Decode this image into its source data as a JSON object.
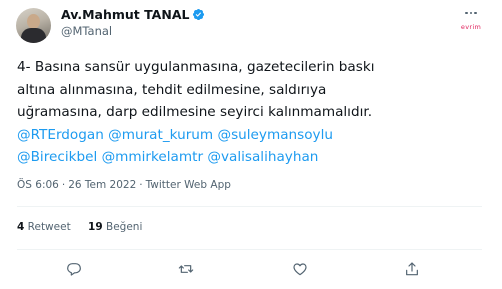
{
  "author": {
    "name": "Av.Mahmut TANAL",
    "handle": "@MTanal",
    "avatar_icon": "avatar-photo",
    "verified_icon": "verified-badge-icon"
  },
  "brand_mark": "evrim",
  "tweet": {
    "lines": [
      [
        {
          "text": "4- Basına sansür uygulanmasına, gazetecilerin baskı"
        }
      ],
      [
        {
          "text": "altına alınmasına, tehdit edilmesine, saldırıya"
        }
      ],
      [
        {
          "text": "uğramasına, darp edilmesine seyirci kalınmamalıdır."
        }
      ],
      [
        {
          "mention": "@RTErdogan"
        },
        {
          "text": " "
        },
        {
          "mention": "@murat_kurum"
        },
        {
          "text": " "
        },
        {
          "mention": "@suleymansoylu"
        }
      ],
      [
        {
          "mention": "@Birecikbel"
        },
        {
          "text": " "
        },
        {
          "mention": "@mmirkelamtr"
        },
        {
          "text": " "
        },
        {
          "mention": "@valisalihayhan"
        }
      ]
    ]
  },
  "meta": {
    "time": "ÖS 6:06",
    "separator": "·",
    "date": "26 Tem 2022",
    "app": "Twitter Web App"
  },
  "stats": {
    "retweets_count": "4",
    "retweets_label": "Retweet",
    "likes_count": "19",
    "likes_label": "Beğeni"
  },
  "actions": [
    "reply-icon",
    "retweet-icon",
    "like-icon",
    "share-icon"
  ],
  "colors": {
    "text": "#0f1419",
    "secondary": "#536471",
    "link": "#1d9bf0",
    "verified": "#1d9bf0",
    "divider": "#eff3f4"
  }
}
